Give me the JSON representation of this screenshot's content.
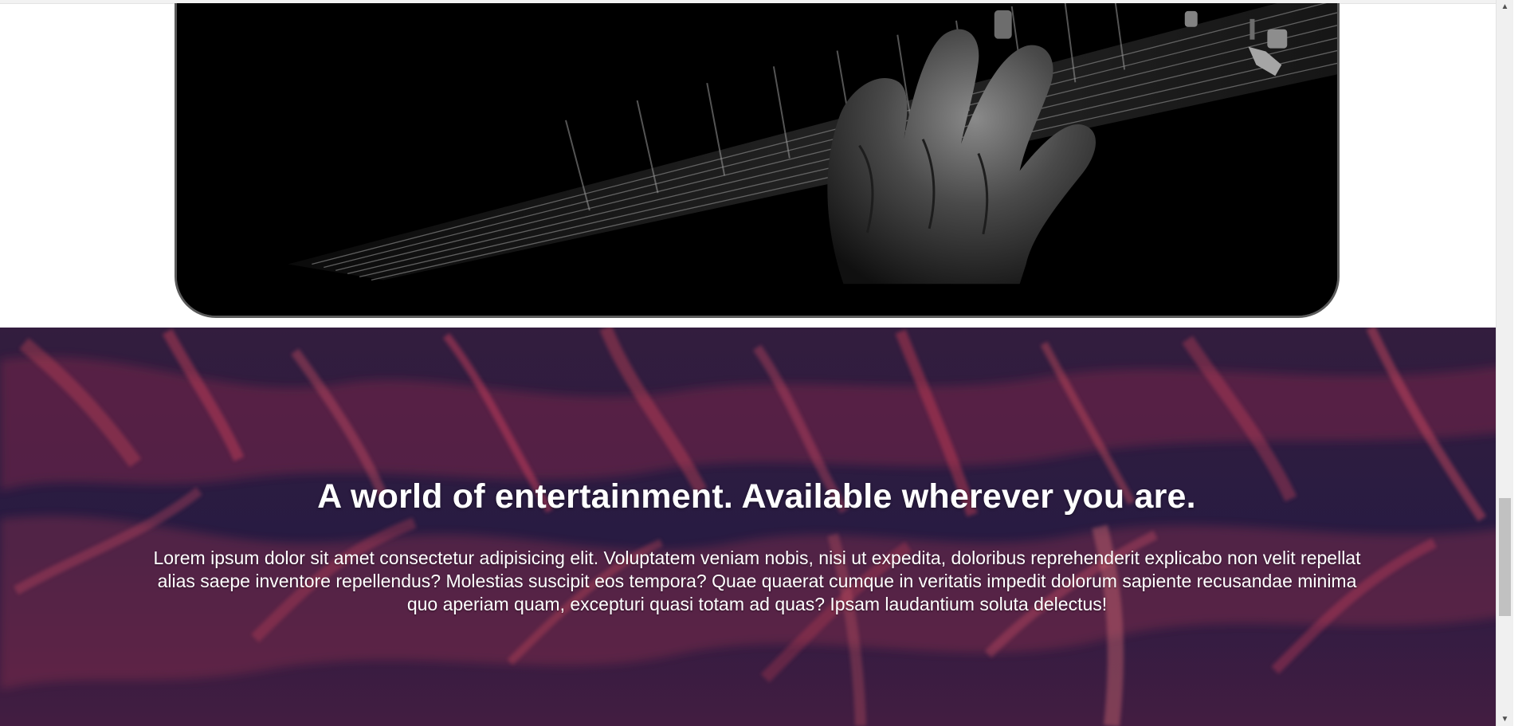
{
  "hero": {
    "title": "A world of entertainment. Available wherever you are.",
    "text": "Lorem ipsum dolor sit amet consectetur adipisicing elit. Voluptatem veniam nobis, nisi ut expedita, doloribus reprehenderit explicabo non velit repellat alias saepe inventore repellendus? Molestias suscipit eos tempora? Quae quaerat cumque in veritatis impedit dolorum sapiente recusandae minima quo aperiam quam, excepturi quasi totam ad quas? Ipsam laudantium soluta delectus!"
  },
  "scrollbar": {
    "up_arrow": "▲",
    "down_arrow": "▼"
  },
  "colors": {
    "hero_background": "#2a1a3f",
    "hero_accent": "#ff4a5f",
    "card_border": "#5a5a5a"
  },
  "icons": {
    "scroll_up": "triangle-up-icon",
    "scroll_down": "triangle-down-icon"
  }
}
